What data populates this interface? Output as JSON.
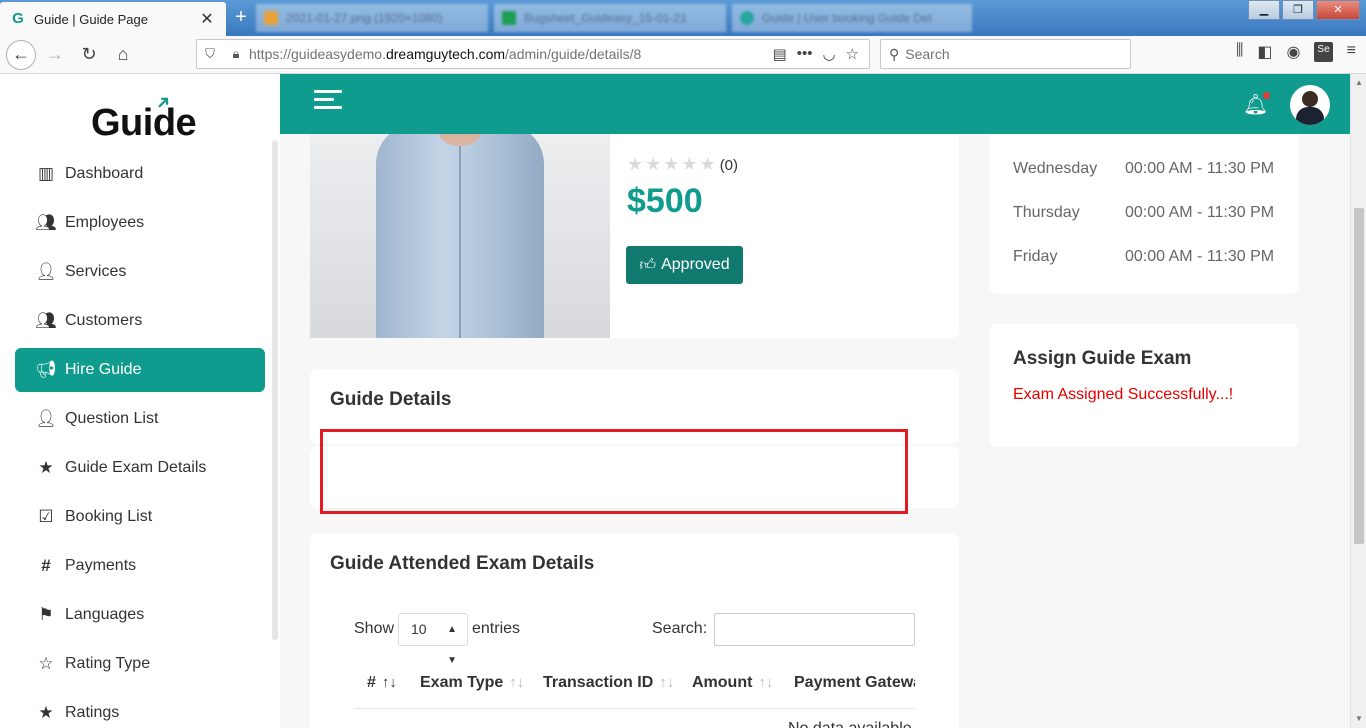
{
  "browser": {
    "active_tab_title": "Guide | Guide Page",
    "favicon_letter": "G",
    "bg_tabs": [
      "2021-01-27.png (1920×1080)",
      "Bugsheet_Guideasy_15-01-21",
      "Guide | User booking Guide Det"
    ],
    "url_prefix": "https://guideasydemo.",
    "url_domain": "dreamguytech.com",
    "url_path": "/admin/guide/details/8",
    "search_placeholder": "Search"
  },
  "sidebar": {
    "logo_text": "Guide",
    "items": [
      {
        "label": "Dashboard",
        "icon": "columns-icon"
      },
      {
        "label": "Employees",
        "icon": "users-icon"
      },
      {
        "label": "Services",
        "icon": "user-tie-icon"
      },
      {
        "label": "Customers",
        "icon": "users-icon"
      },
      {
        "label": "Hire Guide",
        "icon": "megaphone-icon",
        "active": true
      },
      {
        "label": "Question List",
        "icon": "user-icon"
      },
      {
        "label": "Guide Exam Details",
        "icon": "star-icon"
      },
      {
        "label": "Booking List",
        "icon": "calendar-check-icon"
      },
      {
        "label": "Payments",
        "icon": "hashtag-icon"
      },
      {
        "label": "Languages",
        "icon": "flag-icon"
      },
      {
        "label": "Rating Type",
        "icon": "star-half-icon"
      },
      {
        "label": "Ratings",
        "icon": "star-icon"
      }
    ]
  },
  "profile": {
    "rating_count": "(0)",
    "rating_value": 0,
    "rating_max": 5,
    "price": "$500",
    "status_button": "Approved"
  },
  "schedule": [
    {
      "day": "Wednesday",
      "time": "00:00 AM - 11:30 PM"
    },
    {
      "day": "Thursday",
      "time": "00:00 AM - 11:30 PM"
    },
    {
      "day": "Friday",
      "time": "00:00 AM - 11:30 PM"
    }
  ],
  "assign_exam": {
    "title": "Assign Guide Exam",
    "message": "Exam Assigned Successfully...!"
  },
  "guide_details": {
    "title": "Guide Details"
  },
  "attended_exams": {
    "title": "Guide Attended Exam Details",
    "show_label": "Show",
    "entries_value": "10",
    "entries_label": "entries",
    "search_label": "Search:",
    "columns": [
      "#",
      "Exam Type",
      "Transaction ID",
      "Amount",
      "Payment Gatewa"
    ],
    "empty_text": "No data available"
  },
  "colors": {
    "accent": "#0f9b8e",
    "success_text": "#e60000",
    "highlight_border": "#e31b23"
  }
}
